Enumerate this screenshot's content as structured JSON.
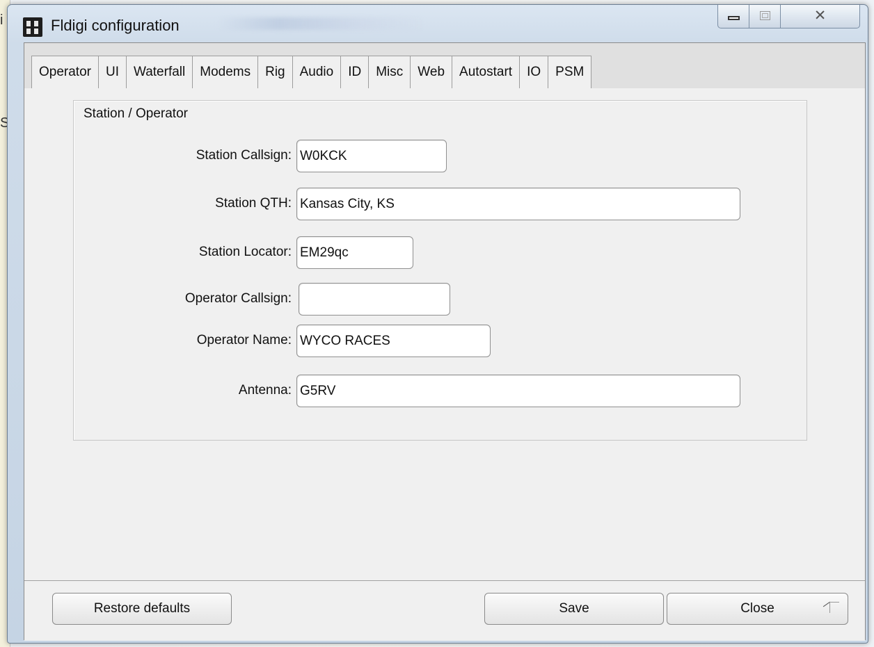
{
  "window": {
    "title": "Fldigi configuration"
  },
  "tabs": [
    {
      "label": "Operator",
      "active": true
    },
    {
      "label": "UI"
    },
    {
      "label": "Waterfall"
    },
    {
      "label": "Modems"
    },
    {
      "label": "Rig"
    },
    {
      "label": "Audio"
    },
    {
      "label": "ID"
    },
    {
      "label": "Misc"
    },
    {
      "label": "Web"
    },
    {
      "label": "Autostart"
    },
    {
      "label": "IO"
    },
    {
      "label": "PSM"
    }
  ],
  "group": {
    "label": "Station / Operator"
  },
  "fields": {
    "station_callsign": {
      "label": "Station Callsign:",
      "value": "W0KCK"
    },
    "station_qth": {
      "label": "Station QTH:",
      "value": "Kansas City, KS"
    },
    "station_locator": {
      "label": "Station Locator:",
      "value": "EM29qc"
    },
    "operator_callsign": {
      "label": "Operator Callsign:",
      "value": ""
    },
    "operator_name": {
      "label": "Operator Name:",
      "value": "WYCO RACES"
    },
    "antenna": {
      "label": "Antenna:",
      "value": "G5RV"
    }
  },
  "buttons": {
    "restore": "Restore defaults",
    "save": "Save",
    "close": "Close"
  },
  "icons": {
    "app": "fldigi-app-icon",
    "minimize": "minimize-icon",
    "maximize": "maximize-icon",
    "close": "close-icon",
    "resize": "resize-grip-icon"
  },
  "colors": {
    "window_frame": "#c5d4e4",
    "client_bg": "#f0f0f0",
    "tabbar_bg": "#e0e0e0"
  }
}
